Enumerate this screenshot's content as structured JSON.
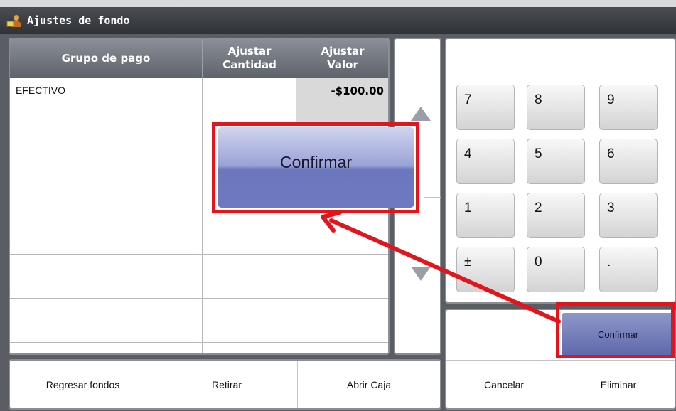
{
  "window": {
    "title": "Ajustes de fondo"
  },
  "table": {
    "headers": [
      "Grupo de pago",
      "Ajustar\nCantidad",
      "Ajustar\nValor"
    ],
    "rows": [
      {
        "group": "EFECTIVO",
        "quantity": "",
        "value": "-$100.00"
      }
    ]
  },
  "keypad": {
    "keys": [
      "7",
      "8",
      "9",
      "4",
      "5",
      "6",
      "1",
      "2",
      "3",
      "±",
      "0",
      "."
    ]
  },
  "actions": {
    "confirm": "Confirmar",
    "cancel": "Cancelar",
    "delete": "Eliminar"
  },
  "bottom": {
    "return_funds": "Regresar fondos",
    "withdraw": "Retirar",
    "open_drawer": "Abrir Caja"
  },
  "callout": {
    "confirm_zoom": "Confirmar"
  },
  "colors": {
    "highlight": "#e3141c",
    "confirm_button": "#6c77be"
  }
}
